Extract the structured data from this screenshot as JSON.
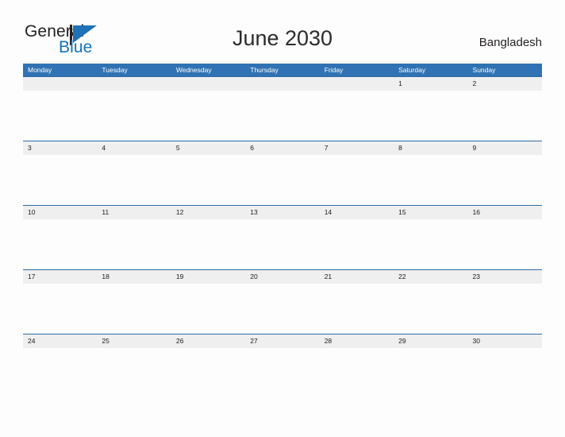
{
  "logo": {
    "word_one": "General",
    "word_two": "Blue",
    "flag_icon": "flag-triangle-icon",
    "brand_blue": "#1273bb",
    "brand_dark": "#231f20"
  },
  "header": {
    "title": "June 2030",
    "country": "Bangladesh"
  },
  "calendar": {
    "header_color": "#3072b3",
    "band_color": "#efefef",
    "rule_color": "#2e6da4",
    "weekdays": [
      "Monday",
      "Tuesday",
      "Wednesday",
      "Thursday",
      "Friday",
      "Saturday",
      "Sunday"
    ],
    "weeks": [
      [
        "",
        "",
        "",
        "",
        "",
        "1",
        "2"
      ],
      [
        "3",
        "4",
        "5",
        "6",
        "7",
        "8",
        "9"
      ],
      [
        "10",
        "11",
        "12",
        "13",
        "14",
        "15",
        "16"
      ],
      [
        "17",
        "18",
        "19",
        "20",
        "21",
        "22",
        "23"
      ],
      [
        "24",
        "25",
        "26",
        "27",
        "28",
        "29",
        "30"
      ]
    ]
  }
}
